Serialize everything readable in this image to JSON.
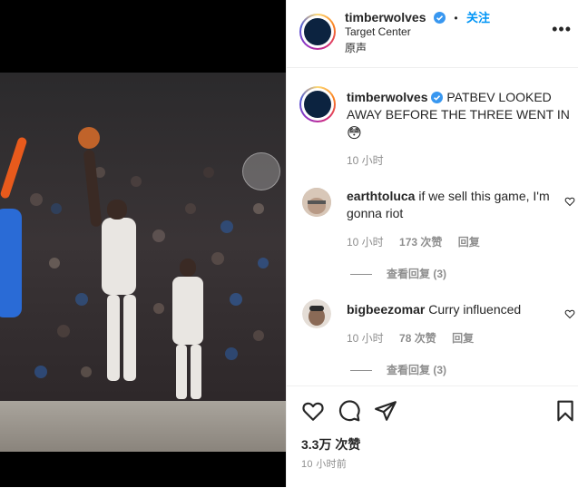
{
  "post": {
    "author": "timberwolves",
    "follow_label": "关注",
    "location": "Target Center",
    "audio": "原声"
  },
  "caption": {
    "username": "timberwolves",
    "text": "PATBEV LOOKED AWAY BEFORE THE THREE WENT IN",
    "emoji": "😳",
    "time": "10 小时"
  },
  "comments": [
    {
      "username": "earthtoluca",
      "text": "if we sell this game, I'm gonna riot",
      "time": "10 小时",
      "likes": "173 次赞",
      "reply_label": "回复",
      "view_replies": "查看回复 (3)"
    },
    {
      "username": "bigbeezomar",
      "text": "Curry influenced",
      "time": "10 小时",
      "likes": "78 次赞",
      "reply_label": "回复",
      "view_replies": "查看回复 (3)"
    }
  ],
  "footer": {
    "likes": "3.3万 次赞",
    "posted": "10 小时前"
  },
  "icons": {
    "more": "more-options-icon",
    "like": "heart-icon",
    "comment": "comment-icon",
    "share": "share-icon",
    "save": "bookmark-icon"
  },
  "colors": {
    "follow": "#0095f6",
    "text": "#262626",
    "secondary": "#8e8e8e",
    "verified": "#3897f0"
  }
}
